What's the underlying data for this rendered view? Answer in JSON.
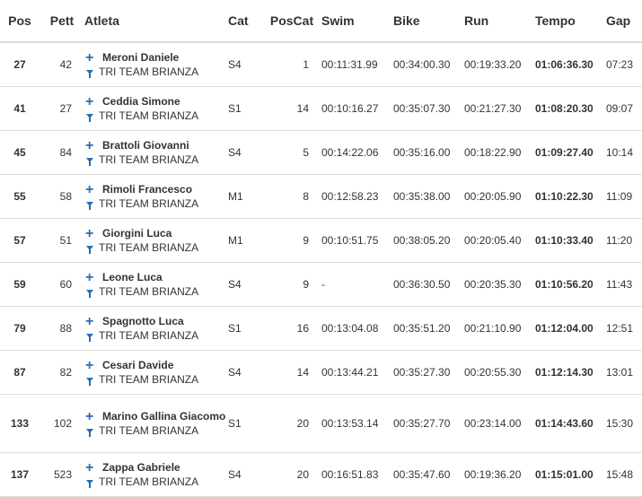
{
  "columns": {
    "pos": "Pos",
    "pett": "Pett",
    "atleta": "Atleta",
    "cat": "Cat",
    "poscat": "PosCat",
    "swim": "Swim",
    "bike": "Bike",
    "run": "Run",
    "tempo": "Tempo",
    "gap": "Gap"
  },
  "rows": [
    {
      "pos": "27",
      "pett": "42",
      "name": "Meroni Daniele",
      "team": "TRI TEAM BRIANZA",
      "cat": "S4",
      "poscat": "1",
      "swim": "00:11:31.99",
      "bike": "00:34:00.30",
      "run": "00:19:33.20",
      "tempo": "01:06:36.30",
      "gap": "07:23"
    },
    {
      "pos": "41",
      "pett": "27",
      "name": "Ceddia Simone",
      "team": "TRI TEAM BRIANZA",
      "cat": "S1",
      "poscat": "14",
      "swim": "00:10:16.27",
      "bike": "00:35:07.30",
      "run": "00:21:27.30",
      "tempo": "01:08:20.30",
      "gap": "09:07"
    },
    {
      "pos": "45",
      "pett": "84",
      "name": "Brattoli Giovanni",
      "team": "TRI TEAM BRIANZA",
      "cat": "S4",
      "poscat": "5",
      "swim": "00:14:22.06",
      "bike": "00:35:16.00",
      "run": "00:18:22.90",
      "tempo": "01:09:27.40",
      "gap": "10:14"
    },
    {
      "pos": "55",
      "pett": "58",
      "name": "Rimoli Francesco",
      "team": "TRI TEAM BRIANZA",
      "cat": "M1",
      "poscat": "8",
      "swim": "00:12:58.23",
      "bike": "00:35:38.00",
      "run": "00:20:05.90",
      "tempo": "01:10:22.30",
      "gap": "11:09"
    },
    {
      "pos": "57",
      "pett": "51",
      "name": "Giorgini Luca",
      "team": "TRI TEAM BRIANZA",
      "cat": "M1",
      "poscat": "9",
      "swim": "00:10:51.75",
      "bike": "00:38:05.20",
      "run": "00:20:05.40",
      "tempo": "01:10:33.40",
      "gap": "11:20"
    },
    {
      "pos": "59",
      "pett": "60",
      "name": "Leone Luca",
      "team": "TRI TEAM BRIANZA",
      "cat": "S4",
      "poscat": "9",
      "swim": "-",
      "bike": "00:36:30.50",
      "run": "00:20:35.30",
      "tempo": "01:10:56.20",
      "gap": "11:43"
    },
    {
      "pos": "79",
      "pett": "88",
      "name": "Spagnotto Luca",
      "team": "TRI TEAM BRIANZA",
      "cat": "S1",
      "poscat": "16",
      "swim": "00:13:04.08",
      "bike": "00:35:51.20",
      "run": "00:21:10.90",
      "tempo": "01:12:04.00",
      "gap": "12:51"
    },
    {
      "pos": "87",
      "pett": "82",
      "name": "Cesari Davide",
      "team": "TRI TEAM BRIANZA",
      "cat": "S4",
      "poscat": "14",
      "swim": "00:13:44.21",
      "bike": "00:35:27.30",
      "run": "00:20:55.30",
      "tempo": "01:12:14.30",
      "gap": "13:01"
    },
    {
      "pos": "133",
      "pett": "102",
      "name": "Marino Gallina Giacomo",
      "team": "TRI TEAM BRIANZA",
      "cat": "S1",
      "poscat": "20",
      "swim": "00:13:53.14",
      "bike": "00:35:27.70",
      "run": "00:23:14.00",
      "tempo": "01:14:43.60",
      "gap": "15:30"
    },
    {
      "pos": "137",
      "pett": "523",
      "name": "Zappa Gabriele",
      "team": "TRI TEAM BRIANZA",
      "cat": "S4",
      "poscat": "20",
      "swim": "00:16:51.83",
      "bike": "00:35:47.60",
      "run": "00:19:36.20",
      "tempo": "01:15:01.00",
      "gap": "15:48"
    }
  ],
  "icons": {
    "expand": "plus-icon",
    "team": "filter-icon"
  },
  "colors": {
    "accent": "#2a6db0",
    "text": "#333333",
    "border": "#dddddd"
  }
}
